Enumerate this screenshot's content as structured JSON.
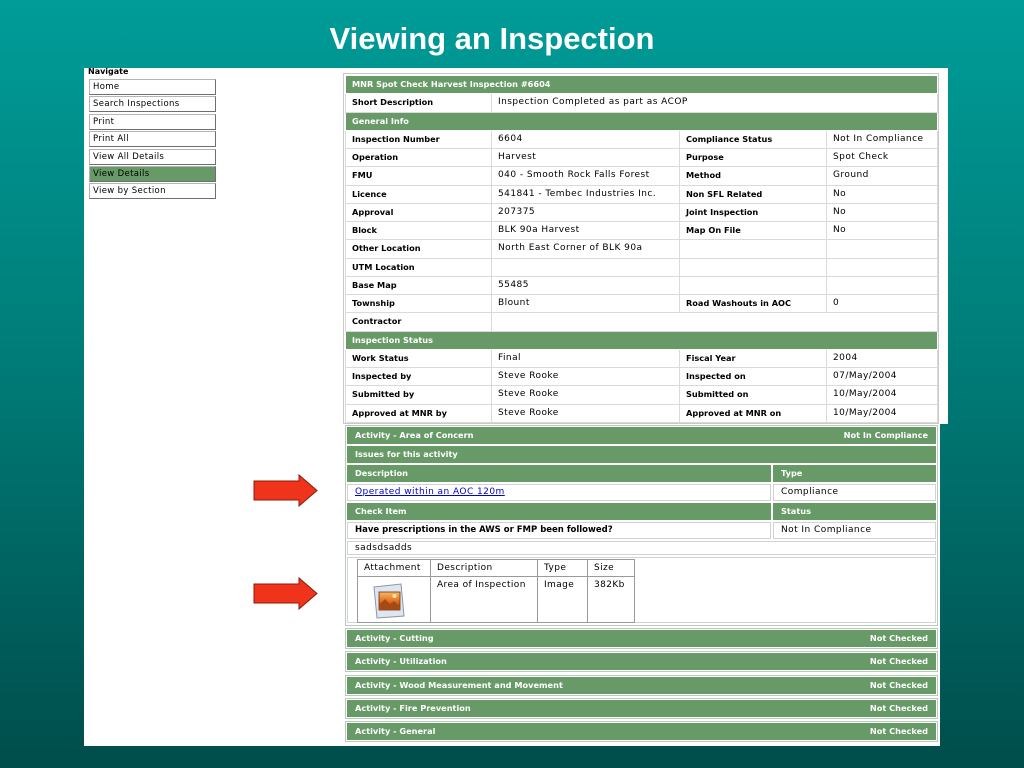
{
  "slide_title": "Viewing an Inspection",
  "colors": {
    "background_top": "#009c98",
    "background_bottom": "#004d4b",
    "section_green": "#689a68",
    "link_blue": "#0000cc",
    "annotation_arrow_red": "#f0341c"
  },
  "annotation_icon": "arrow-right-icon",
  "nav": {
    "heading": "Navigate",
    "items": [
      {
        "label": "Home"
      },
      {
        "label": "Search Inspections"
      },
      {
        "label": "Print"
      },
      {
        "label": "Print All"
      },
      {
        "label": "View All Details"
      },
      {
        "label": "View Details",
        "active": true
      },
      {
        "label": "View by Section"
      }
    ]
  },
  "inspection": {
    "title": "MNR Spot Check Harvest Inspection #6604",
    "short_description_label": "Short Description",
    "short_description": "Inspection Completed as part as ACOP",
    "general_info": {
      "heading": "General Info",
      "rows": [
        [
          "Inspection Number",
          "6604",
          "Compliance Status",
          "Not In Compliance"
        ],
        [
          "Operation",
          "Harvest",
          "Purpose",
          "Spot Check"
        ],
        [
          "FMU",
          "040 - Smooth Rock Falls Forest",
          "Method",
          "Ground"
        ],
        [
          "Licence",
          "541841 - Tembec Industries Inc.",
          "Non SFL Related",
          "No"
        ],
        [
          "Approval",
          "207375",
          "Joint Inspection",
          "No"
        ],
        [
          "Block",
          "BLK 90a Harvest",
          "Map On File",
          "No"
        ],
        [
          "Other Location",
          "North East Corner of BLK 90a"
        ],
        [
          "UTM Location"
        ],
        [
          "Base Map",
          "55485"
        ],
        [
          "Township",
          "Blount",
          "Road Washouts in AOC",
          "0"
        ],
        [
          "Contractor"
        ]
      ]
    },
    "inspection_status": {
      "heading": "Inspection Status",
      "rows": [
        [
          "Work Status",
          "Final",
          "Fiscal Year",
          "2004"
        ],
        [
          "Inspected by",
          "Steve Rooke",
          "Inspected on",
          "07/May/2004"
        ],
        [
          "Submitted by",
          "Steve Rooke",
          "Submitted on",
          "10/May/2004"
        ],
        [
          "Approved at MNR by",
          "Steve Rooke",
          "Approved at MNR on",
          "10/May/2004"
        ]
      ]
    }
  },
  "activities": {
    "expanded": {
      "title": "Activity - Area of Concern",
      "status": "Not In Compliance",
      "issues_heading": "Issues for this activity",
      "issue_columns": [
        "Description",
        "Type"
      ],
      "issues": [
        {
          "description": "Operated within an AOC 120m",
          "type": "Compliance"
        }
      ],
      "check_columns": [
        "Check Item",
        "Status"
      ],
      "checks": [
        {
          "item": "Have prescriptions in the AWS or FMP been followed?",
          "status": "Not In Compliance"
        }
      ],
      "comment": "sadsdsadds",
      "attachment_columns": [
        "Attachment",
        "Description",
        "Type",
        "Size"
      ],
      "attachments": [
        {
          "icon": "image-file-icon",
          "description": "Area of Inspection",
          "type": "Image",
          "size": "382Kb"
        }
      ]
    },
    "collapsed": [
      {
        "title": "Activity - Cutting",
        "status": "Not Checked"
      },
      {
        "title": "Activity - Utilization",
        "status": "Not Checked"
      },
      {
        "title": "Activity - Wood Measurement and Movement",
        "status": "Not Checked"
      },
      {
        "title": "Activity - Fire Prevention",
        "status": "Not Checked"
      },
      {
        "title": "Activity - General",
        "status": "Not Checked"
      }
    ]
  }
}
